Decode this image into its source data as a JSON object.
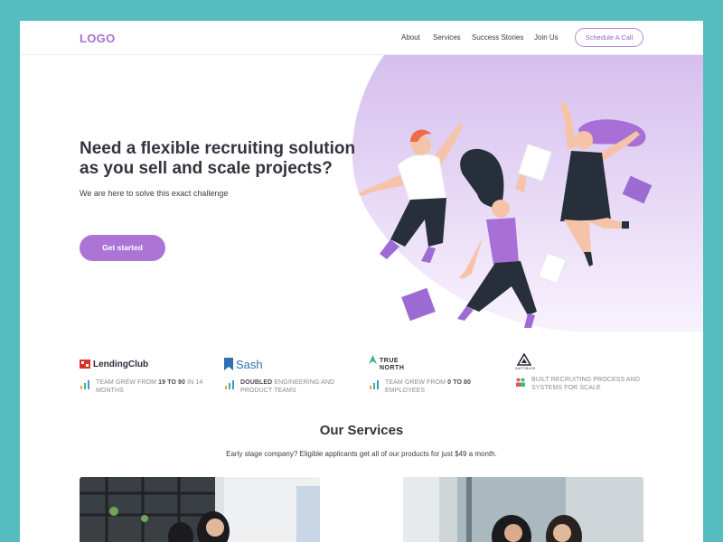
{
  "nav": {
    "logo": "LOGO",
    "links": [
      "About",
      "Services",
      "Success Stories",
      "Join Us"
    ],
    "cta": "Schedule A Call"
  },
  "hero": {
    "title": "Need a flexible recruiting solution as you sell and scale projects?",
    "subtitle": "We are here to solve this exact challenge",
    "button": "Get started"
  },
  "clients": [
    {
      "name": "LendingClub",
      "stat_pre": "Team grew from ",
      "stat_bold": "19 to 90",
      "stat_post": " in 14 months"
    },
    {
      "name": "Sash",
      "stat_pre": "",
      "stat_bold": "Doubled",
      "stat_post": " engineering and product teams"
    },
    {
      "name_line1": "TRUE",
      "name_line2": "NORTH",
      "stat_pre": "Team grew from ",
      "stat_bold": "0 to 80",
      "stat_post": " employees"
    },
    {
      "name": "SAPTIBLES",
      "stat_pre": "",
      "stat_bold": "",
      "stat_post": "Built recruiting process and systems for scale"
    }
  ],
  "services": {
    "title": "Our Services",
    "subtitle": "Early stage company? Eligible applicants get all of our products for just $49 a month."
  },
  "colors": {
    "accent": "#ad74d8",
    "background": "#55bcbf",
    "blob": "#dcc8ee"
  }
}
